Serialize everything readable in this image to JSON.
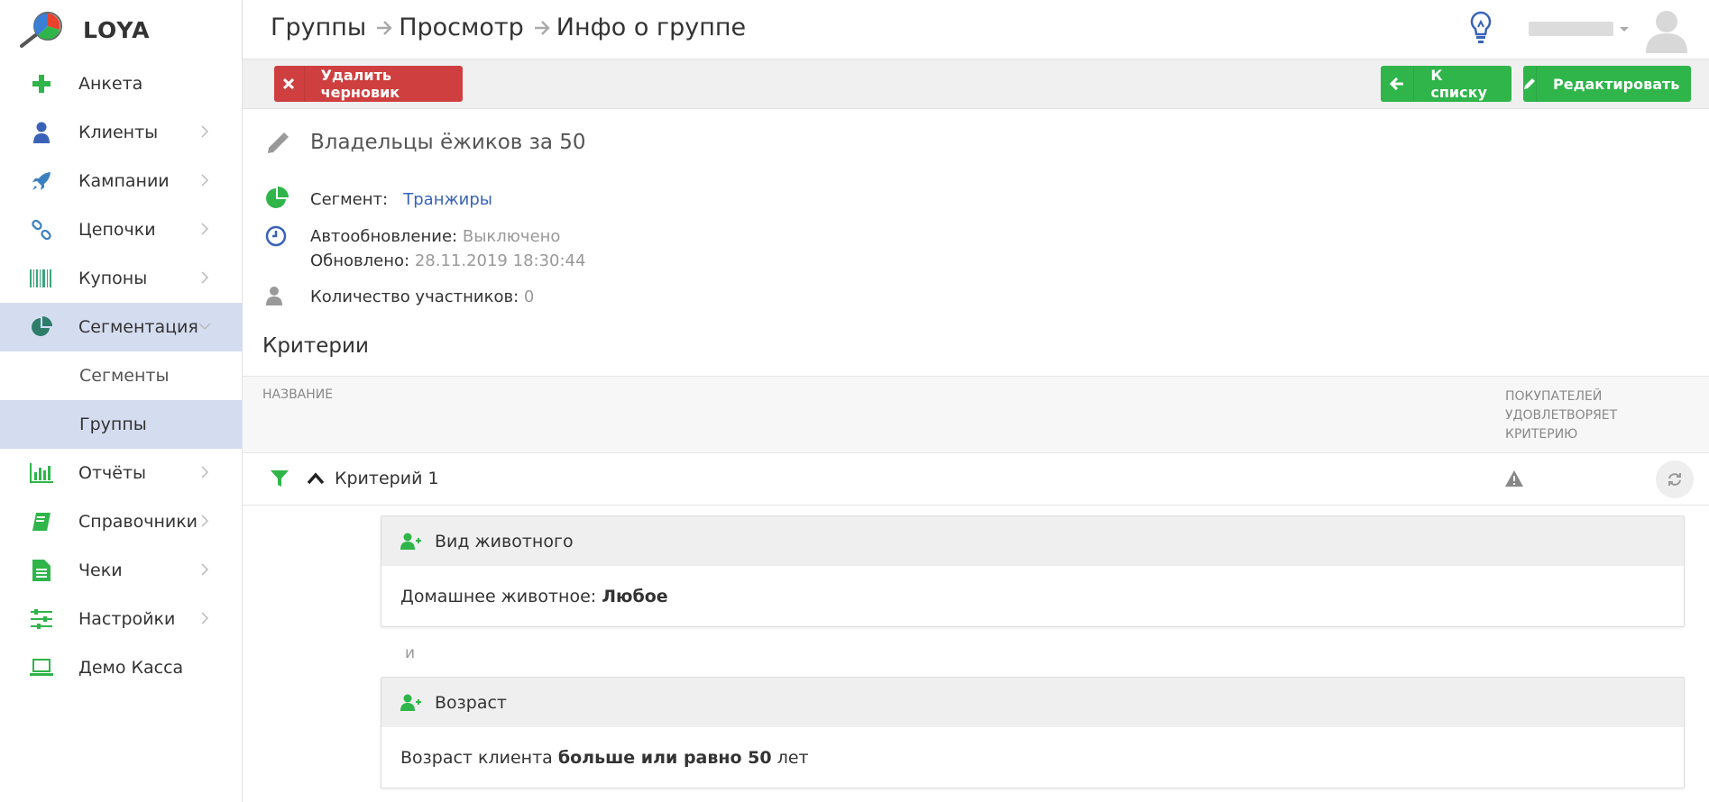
{
  "app": {
    "logo_text": "LOYA"
  },
  "sidebar": {
    "items": [
      {
        "label": "Анкета"
      },
      {
        "label": "Клиенты"
      },
      {
        "label": "Кампании"
      },
      {
        "label": "Цепочки"
      },
      {
        "label": "Купоны"
      },
      {
        "label": "Сегментация"
      },
      {
        "label": "Отчёты"
      },
      {
        "label": "Справочники"
      },
      {
        "label": "Чеки"
      },
      {
        "label": "Настройки"
      },
      {
        "label": "Демо Касса"
      }
    ],
    "sub_items": [
      {
        "label": "Сегменты"
      },
      {
        "label": "Группы"
      }
    ],
    "active_item": "Сегментация",
    "active_sub_item": "Группы"
  },
  "header": {
    "breadcrumb": [
      "Группы",
      "Просмотр",
      "Инфо о группе"
    ]
  },
  "toolbar": {
    "delete_draft_label": "Удалить черновик",
    "back_label": "К списку",
    "edit_label": "Редактировать"
  },
  "group": {
    "title": "Владельцы ёжиков за 50",
    "segment_label": "Сегмент:",
    "segment_value": "Транжиры",
    "autoupdate_label": "Автообновление:",
    "autoupdate_value": "Выключено",
    "updated_label": "Обновлено:",
    "updated_value": "28.11.2019 18:30:44",
    "members_label": "Количество участников:",
    "members_value": "0"
  },
  "criteria": {
    "title": "Критерии",
    "col_name": "НАЗВАНИЕ",
    "col_buyers": "ПОКУПАТЕЛЕЙ УДОВЛЕТВОРЯЕТ КРИТЕРИЮ",
    "criterion_label": "Критерий 1",
    "connector": "и",
    "cards": [
      {
        "title": "Вид животного",
        "text_prefix": "Домашнее животное:",
        "text_bold": "Любое",
        "text_suffix": ""
      },
      {
        "title": "Возраст",
        "text_prefix": "Возраст клиента",
        "text_bold": "больше или равно 50",
        "text_suffix": "лет"
      }
    ]
  },
  "colors": {
    "green": "#2fb54a",
    "red": "#cf3f3f",
    "blue_link": "#3a63b8",
    "active_nav": "#d4ddf0"
  }
}
